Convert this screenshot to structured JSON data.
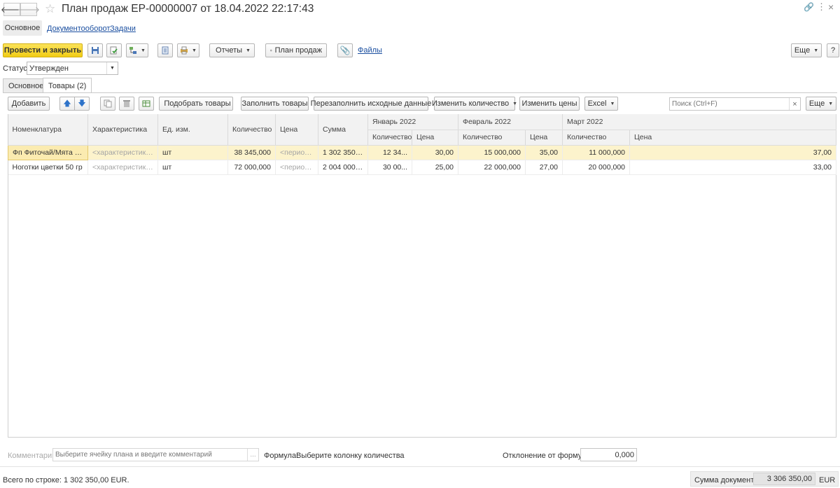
{
  "window": {
    "title": "План продаж ЕР-00000007 от 18.04.2022 22:17:43",
    "tabs": [
      {
        "label": "Основное",
        "active": true
      },
      {
        "label": "Документооборот",
        "active": false
      },
      {
        "label": "Задачи",
        "active": false
      }
    ]
  },
  "toolbar": {
    "post_close": "Провести и закрыть",
    "reports": "Отчеты",
    "plan": "План продаж",
    "files": "Файлы",
    "more": "Еще",
    "help": "?"
  },
  "status": {
    "label": "Статус:",
    "value": "Утвержден"
  },
  "subtabs": [
    {
      "label": "Основное",
      "active": false
    },
    {
      "label": "Товары (2)",
      "active": true
    }
  ],
  "tbl_toolbar": {
    "add": "Добавить",
    "pick": "Подобрать товары",
    "fill": "Заполнить товары",
    "refill": "Перезаполнить исходные данные",
    "change_qty": "Изменить количество",
    "change_prices": "Изменить цены",
    "excel": "Excel",
    "search_placeholder": "Поиск (Ctrl+F)",
    "search_clear": "×",
    "more": "Еще"
  },
  "table": {
    "columns": [
      "Номенклатура",
      "Характеристика",
      "Ед. изм.",
      "Количество",
      "Цена",
      "Сумма"
    ],
    "months": [
      "Январь 2022",
      "Февраль 2022",
      "Март 2022"
    ],
    "sub": [
      "Количество",
      "Цена"
    ],
    "rows": [
      {
        "nom": "Фп Фиточай/Мята (Ф...",
        "char": "<характеристики ...",
        "unit": "шт",
        "qty": "38 345,000",
        "price": "<период...",
        "sum": "1 302 350,00",
        "m1q": "12 34...",
        "m1p": "30,00",
        "m2q": "15 000,000",
        "m2p": "35,00",
        "m3q": "11 000,000",
        "m3p": "37,00"
      },
      {
        "nom": "Ноготки цветки 50 гр",
        "char": "<характеристики ...",
        "unit": "шт",
        "qty": "72 000,000",
        "price": "<период...",
        "sum": "2 004 000,00",
        "m1q": "30 00...",
        "m1p": "25,00",
        "m2q": "22 000,000",
        "m2p": "27,00",
        "m3q": "20 000,000",
        "m3p": "33,00"
      }
    ]
  },
  "footer": {
    "comment_label": "Комментарий:",
    "comment_placeholder": "Выберите ячейку плана и введите комментарий",
    "comment_btn": "...",
    "formula_label": "Формула:",
    "formula_value": "Выберите колонку количества",
    "deviation_label": "Отклонение от формулы:",
    "deviation_value": "0,000",
    "row_total": "Всего по строке: 1 302 350,00 EUR.",
    "doc_sum_label": "Сумма документа:",
    "doc_sum_value": "3 306 350,00",
    "currency": "EUR"
  },
  "icons": [
    "arrow-left-icon",
    "arrow-right-icon",
    "star-icon",
    "link-icon",
    "more-icon",
    "close-icon",
    "save-icon",
    "post-icon",
    "structure-icon",
    "list-icon",
    "print-icon",
    "paperclip-icon",
    "arrow-up-icon",
    "arrow-down-icon",
    "copy-icon",
    "delete-icon",
    "table-settings-icon",
    "bag-icon"
  ],
  "colors": {
    "primary_button": "#f5d423",
    "selected_row": "#fcf3cc",
    "link": "#1b4fa0"
  }
}
